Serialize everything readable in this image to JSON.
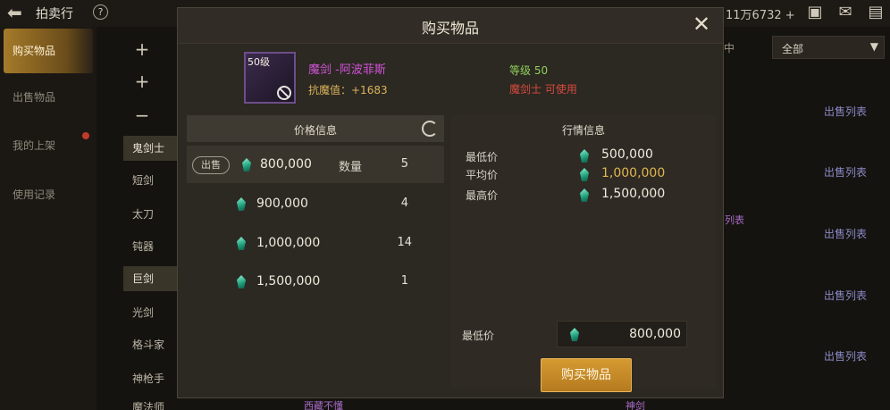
{
  "topbar": {
    "title": "拍卖行",
    "help": "?",
    "currency": "11万6732 +"
  },
  "left_nav": [
    {
      "label": "购买物品",
      "active": true
    },
    {
      "label": "出售物品",
      "active": false
    },
    {
      "label": "我的上架",
      "active": false
    },
    {
      "label": "使用记录",
      "active": false
    }
  ],
  "categories": {
    "symbols": [
      "+",
      "+",
      "−"
    ],
    "items": [
      "鬼剑士",
      "短剑",
      "太刀",
      "钝器",
      "巨剑",
      "光剑",
      "格斗家",
      "神枪手",
      "魔法师"
    ]
  },
  "filter": {
    "label": "全部",
    "prefix": "中"
  },
  "sell_list_label": "出售列表",
  "bg_fragments": [
    "列表",
    "西藏不懂",
    "神剑"
  ],
  "dialog": {
    "title": "购买物品",
    "item": {
      "level_badge": "50级",
      "name": "魔剑 -阿波菲斯",
      "resist": "抗魔值：+1683",
      "level": "等级 50",
      "usable": "魔剑士 可使用"
    },
    "price_info": {
      "header": "价格信息",
      "sell_tag": "出售",
      "qty_label": "数量",
      "rows": [
        {
          "price": "800,000",
          "qty": "5"
        },
        {
          "price": "900,000",
          "qty": "4"
        },
        {
          "price": "1,000,000",
          "qty": "14"
        },
        {
          "price": "1,500,000",
          "qty": "1"
        }
      ]
    },
    "market": {
      "header": "行情信息",
      "rows": [
        {
          "label": "最低价",
          "value": "500,000",
          "color": "#f0ebdd"
        },
        {
          "label": "平均价",
          "value": "1,000,000",
          "color": "#e0b64f"
        },
        {
          "label": "最高价",
          "value": "1,500,000",
          "color": "#f0ebdd"
        }
      ],
      "min_label": "最低价",
      "min_value": "800,000"
    },
    "buy_button": "购买物品"
  }
}
